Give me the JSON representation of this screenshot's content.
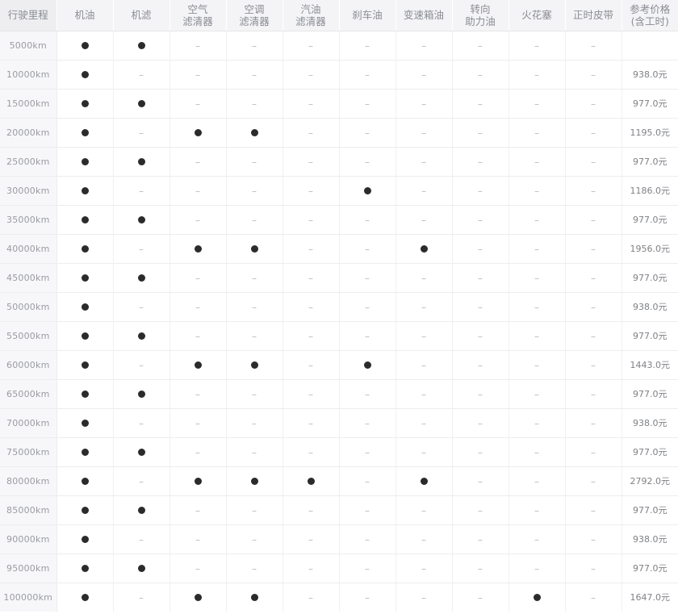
{
  "table": {
    "columns": [
      {
        "key": "mileage",
        "label_lines": [
          "行驶里程"
        ]
      },
      {
        "key": "engine_oil",
        "label_lines": [
          "机油"
        ]
      },
      {
        "key": "oil_filter",
        "label_lines": [
          "机滤"
        ]
      },
      {
        "key": "air_filter",
        "label_lines": [
          "空气",
          "滤清器"
        ]
      },
      {
        "key": "ac_filter",
        "label_lines": [
          "空调",
          "滤清器"
        ]
      },
      {
        "key": "fuel_filter",
        "label_lines": [
          "汽油",
          "滤清器"
        ]
      },
      {
        "key": "brake_fluid",
        "label_lines": [
          "刹车油"
        ]
      },
      {
        "key": "gearbox_oil",
        "label_lines": [
          "变速箱油"
        ]
      },
      {
        "key": "power_steering_oil",
        "label_lines": [
          "转向",
          "助力油"
        ]
      },
      {
        "key": "spark_plug",
        "label_lines": [
          "火花塞"
        ]
      },
      {
        "key": "timing_belt",
        "label_lines": [
          "正时皮带"
        ]
      },
      {
        "key": "price",
        "label_lines": [
          "参考价格",
          "(含工时)"
        ]
      }
    ],
    "marks": {
      "replace": "●",
      "none": "–"
    },
    "rows": [
      {
        "mileage": "5000km",
        "cells": [
          "●",
          "●",
          "–",
          "–",
          "–",
          "–",
          "–",
          "–",
          "–",
          "–"
        ],
        "price": ""
      },
      {
        "mileage": "10000km",
        "cells": [
          "●",
          "–",
          "–",
          "–",
          "–",
          "–",
          "–",
          "–",
          "–",
          "–"
        ],
        "price": "938.0元"
      },
      {
        "mileage": "15000km",
        "cells": [
          "●",
          "●",
          "–",
          "–",
          "–",
          "–",
          "–",
          "–",
          "–",
          "–"
        ],
        "price": "977.0元"
      },
      {
        "mileage": "20000km",
        "cells": [
          "●",
          "–",
          "●",
          "●",
          "–",
          "–",
          "–",
          "–",
          "–",
          "–"
        ],
        "price": "1195.0元"
      },
      {
        "mileage": "25000km",
        "cells": [
          "●",
          "●",
          "–",
          "–",
          "–",
          "–",
          "–",
          "–",
          "–",
          "–"
        ],
        "price": "977.0元"
      },
      {
        "mileage": "30000km",
        "cells": [
          "●",
          "–",
          "–",
          "–",
          "–",
          "●",
          "–",
          "–",
          "–",
          "–"
        ],
        "price": "1186.0元"
      },
      {
        "mileage": "35000km",
        "cells": [
          "●",
          "●",
          "–",
          "–",
          "–",
          "–",
          "–",
          "–",
          "–",
          "–"
        ],
        "price": "977.0元"
      },
      {
        "mileage": "40000km",
        "cells": [
          "●",
          "–",
          "●",
          "●",
          "–",
          "–",
          "●",
          "–",
          "–",
          "–"
        ],
        "price": "1956.0元"
      },
      {
        "mileage": "45000km",
        "cells": [
          "●",
          "●",
          "–",
          "–",
          "–",
          "–",
          "–",
          "–",
          "–",
          "–"
        ],
        "price": "977.0元"
      },
      {
        "mileage": "50000km",
        "cells": [
          "●",
          "–",
          "–",
          "–",
          "–",
          "–",
          "–",
          "–",
          "–",
          "–"
        ],
        "price": "938.0元"
      },
      {
        "mileage": "55000km",
        "cells": [
          "●",
          "●",
          "–",
          "–",
          "–",
          "–",
          "–",
          "–",
          "–",
          "–"
        ],
        "price": "977.0元"
      },
      {
        "mileage": "60000km",
        "cells": [
          "●",
          "–",
          "●",
          "●",
          "–",
          "●",
          "–",
          "–",
          "–",
          "–"
        ],
        "price": "1443.0元"
      },
      {
        "mileage": "65000km",
        "cells": [
          "●",
          "●",
          "–",
          "–",
          "–",
          "–",
          "–",
          "–",
          "–",
          "–"
        ],
        "price": "977.0元"
      },
      {
        "mileage": "70000km",
        "cells": [
          "●",
          "–",
          "–",
          "–",
          "–",
          "–",
          "–",
          "–",
          "–",
          "–"
        ],
        "price": "938.0元"
      },
      {
        "mileage": "75000km",
        "cells": [
          "●",
          "●",
          "–",
          "–",
          "–",
          "–",
          "–",
          "–",
          "–",
          "–"
        ],
        "price": "977.0元"
      },
      {
        "mileage": "80000km",
        "cells": [
          "●",
          "–",
          "●",
          "●",
          "●",
          "–",
          "●",
          "–",
          "–",
          "–"
        ],
        "price": "2792.0元"
      },
      {
        "mileage": "85000km",
        "cells": [
          "●",
          "●",
          "–",
          "–",
          "–",
          "–",
          "–",
          "–",
          "–",
          "–"
        ],
        "price": "977.0元"
      },
      {
        "mileage": "90000km",
        "cells": [
          "●",
          "–",
          "–",
          "–",
          "–",
          "–",
          "–",
          "–",
          "–",
          "–"
        ],
        "price": "938.0元"
      },
      {
        "mileage": "95000km",
        "cells": [
          "●",
          "●",
          "–",
          "–",
          "–",
          "–",
          "–",
          "–",
          "–",
          "–"
        ],
        "price": "977.0元"
      },
      {
        "mileage": "100000km",
        "cells": [
          "●",
          "–",
          "●",
          "●",
          "–",
          "–",
          "–",
          "–",
          "●",
          "–"
        ],
        "price": "1647.0元"
      }
    ]
  },
  "colors": {
    "header_bg": "#f4f4f6",
    "mileage_col_bg": "#f7f7f9",
    "dot": "#2b2b2b",
    "text": "#8a8d93",
    "border": "#ededef"
  }
}
